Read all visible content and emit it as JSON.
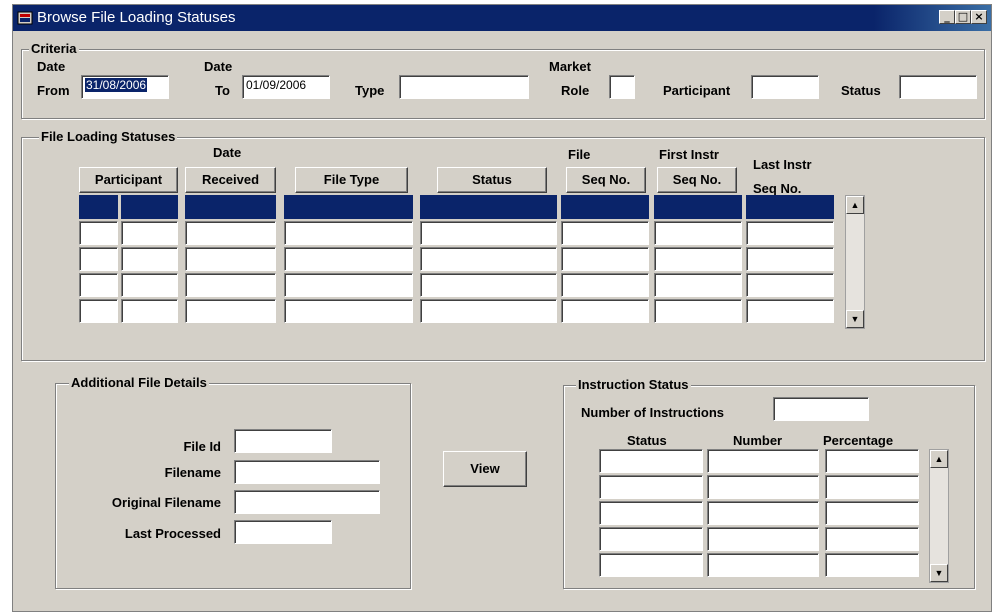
{
  "window": {
    "title": "Browse File Loading Statuses"
  },
  "criteria": {
    "legend": "Criteria",
    "date_from_label_1": "Date",
    "date_from_label_2": "From",
    "date_from_value": "31/08/2006",
    "date_to_label_1": "Date",
    "date_to_label_2": "To",
    "date_to_value": "01/09/2006",
    "type_label": "Type",
    "type_value": "",
    "market_role_label_1": "Market",
    "market_role_label_2": "Role",
    "market_role_value": "",
    "participant_label": "Participant",
    "participant_value": "",
    "status_label": "Status",
    "status_value": ""
  },
  "statuses": {
    "legend": "File Loading Statuses",
    "participant_button": "Participant",
    "date_label": "Date",
    "received_button": "Received",
    "file_type_button": "File Type",
    "status_button": "Status",
    "file_label": "File",
    "seq_no_button": "Seq No.",
    "first_instr_label": "First Instr",
    "first_seq_no_button": "Seq No.",
    "last_instr_label": "Last Instr",
    "last_seq_no_label": "Seq No."
  },
  "details": {
    "legend": "Additional File Details",
    "file_id_label": "File Id",
    "file_id_value": "",
    "filename_label": "Filename",
    "filename_value": "",
    "original_filename_label": "Original Filename",
    "original_filename_value": "",
    "last_processed_label": "Last Processed",
    "last_processed_value": ""
  },
  "view_button": "View",
  "instruction": {
    "legend": "Instruction Status",
    "number_label": "Number of Instructions",
    "number_value": "",
    "status_header": "Status",
    "number_header": "Number",
    "percentage_header": "Percentage"
  },
  "icons": {
    "minimize": "minimize-icon",
    "maximize": "maximize-icon",
    "close": "close-icon",
    "scroll_up": "scroll-up-arrow-icon",
    "scroll_down": "scroll-down-arrow-icon"
  }
}
